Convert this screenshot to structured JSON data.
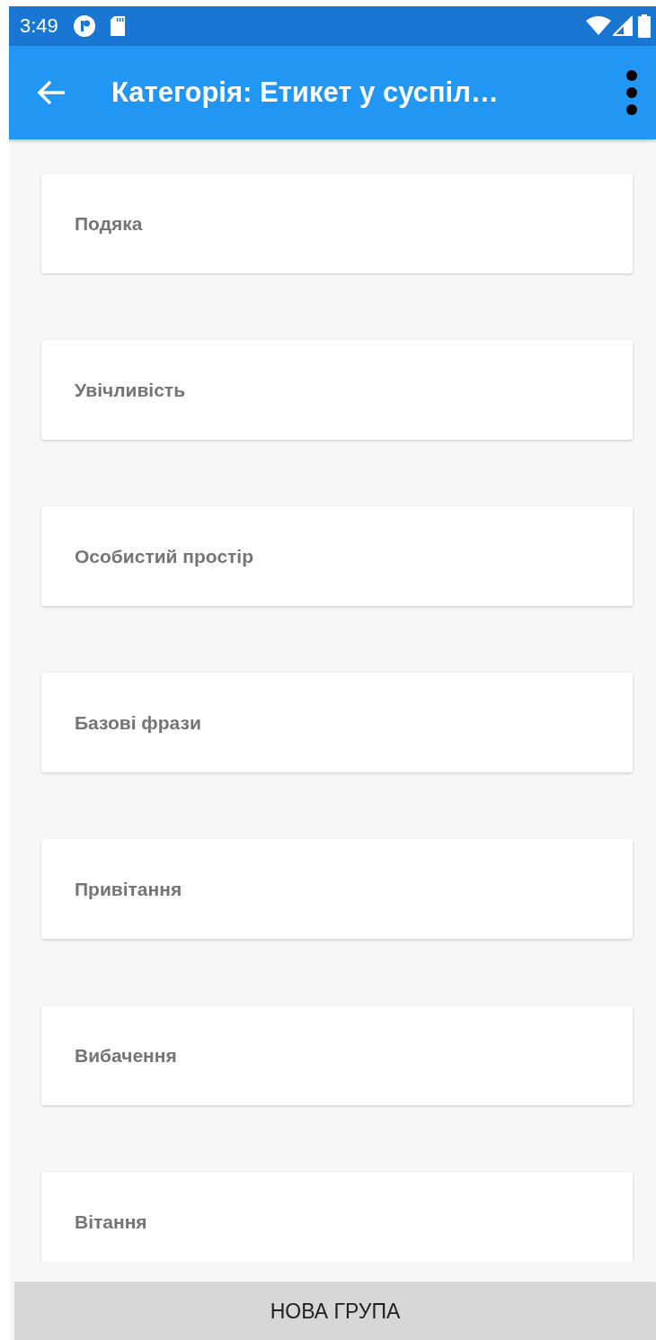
{
  "status_bar": {
    "time": "3:49"
  },
  "app_bar": {
    "title": "Категорія: Етикет у суспіл…"
  },
  "groups": [
    {
      "label": "Подяка"
    },
    {
      "label": "Увічливість"
    },
    {
      "label": "Особистий простір"
    },
    {
      "label": "Базові фрази"
    },
    {
      "label": "Привітання"
    },
    {
      "label": "Вибачення"
    },
    {
      "label": "Вітання"
    }
  ],
  "bottom_button": {
    "label": "НОВА ГРУПА"
  }
}
